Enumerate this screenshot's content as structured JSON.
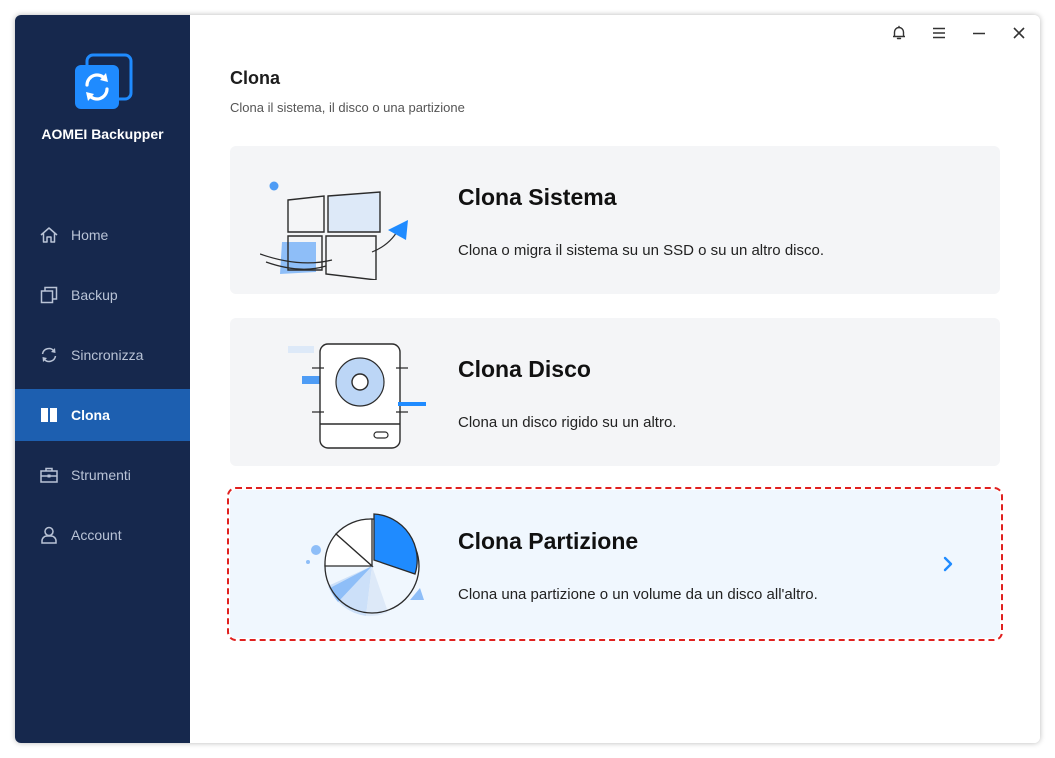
{
  "app": {
    "name": "AOMEI Backupper",
    "logo_icon": "aomei-sync-logo-icon"
  },
  "colors": {
    "sidebar": "#16284d",
    "active": "#1d5fb0",
    "accent": "#0a7bf0",
    "highlight_border": "#e0201f"
  },
  "titlebar": {
    "buttons": [
      {
        "name": "notification-bell",
        "icon": "bell-icon"
      },
      {
        "name": "menu",
        "icon": "hamburger-menu-icon"
      },
      {
        "name": "minimize",
        "icon": "minimize-icon"
      },
      {
        "name": "close",
        "icon": "close-icon"
      }
    ]
  },
  "sidebar": {
    "items": [
      {
        "label": "Home",
        "icon": "home-icon",
        "active": false
      },
      {
        "label": "Backup",
        "icon": "backup-copy-icon",
        "active": false
      },
      {
        "label": "Sincronizza",
        "icon": "sync-icon",
        "active": false
      },
      {
        "label": "Clona",
        "icon": "clone-book-icon",
        "active": true
      },
      {
        "label": "Strumenti",
        "icon": "toolbox-icon",
        "active": false
      },
      {
        "label": "Account",
        "icon": "user-icon",
        "active": false
      }
    ]
  },
  "page": {
    "title": "Clona",
    "subtitle": "Clona il sistema, il disco o una partizione"
  },
  "cards": [
    {
      "title": "Clona Sistema",
      "description": "Clona o migra il sistema su un SSD o su un altro disco.",
      "icon": "windows-system-clone-icon",
      "highlighted": false
    },
    {
      "title": "Clona Disco",
      "description": "Clona un disco rigido su un altro.",
      "icon": "hard-disk-clone-icon",
      "highlighted": false
    },
    {
      "title": "Clona Partizione",
      "description": "Clona una partizione o un volume da un disco all'altro.",
      "icon": "pie-partition-clone-icon",
      "highlighted": true,
      "chevron_icon": "chevron-right-icon"
    }
  ]
}
